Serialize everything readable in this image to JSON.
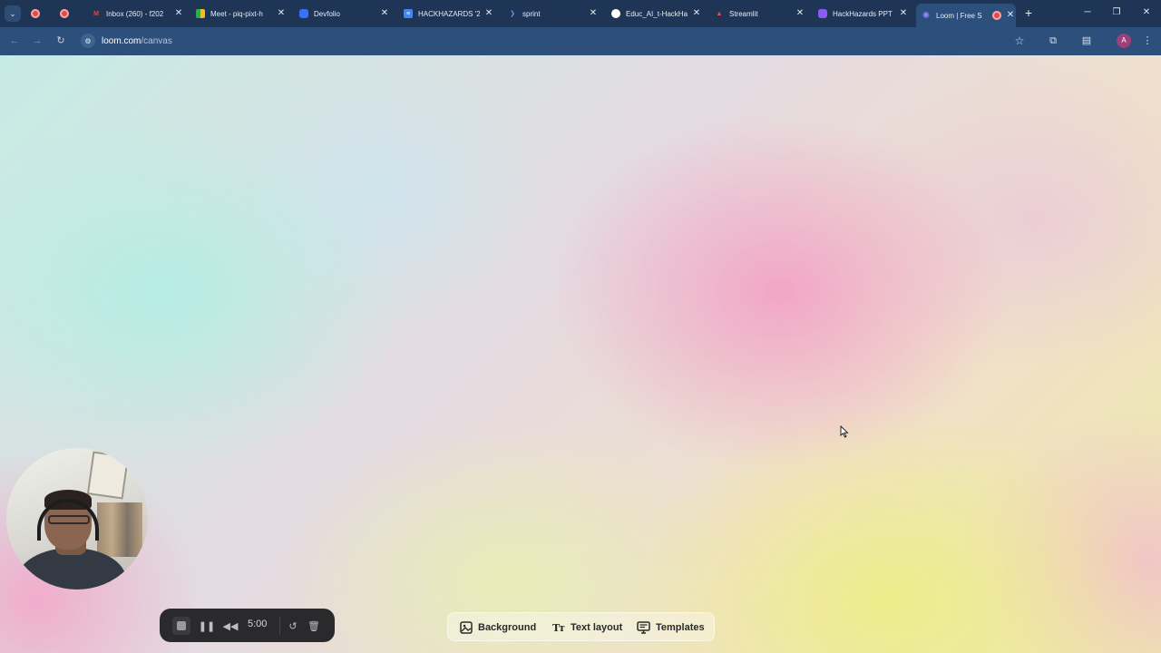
{
  "browser": {
    "tabs": [
      {
        "title": "",
        "favicon": "record-icon",
        "color": "#e5484d"
      },
      {
        "title": "",
        "favicon": "record-icon",
        "color": "#e5484d"
      },
      {
        "title": "Inbox (260) - f202",
        "favicon": "gmail-icon",
        "color": "#ea4335"
      },
      {
        "title": "Meet - piq-pixt-h",
        "favicon": "meet-icon",
        "color": "#34a853"
      },
      {
        "title": "Devfolio",
        "favicon": "devfolio-icon",
        "color": "#3770ff"
      },
      {
        "title": "HACKHAZARDS '2",
        "favicon": "docs-icon",
        "color": "#4285f4"
      },
      {
        "title": "sprint",
        "favicon": "sprint-icon",
        "color": "#6b7cff"
      },
      {
        "title": "Educ_AI_t-HackHa",
        "favicon": "github-icon",
        "color": "#ffffff"
      },
      {
        "title": "Streamlit",
        "favicon": "streamlit-icon",
        "color": "#ff4b4b"
      },
      {
        "title": "HackHazards PPT",
        "favicon": "hackhazards-icon",
        "color": "#8a5cf6"
      },
      {
        "title": "Loom | Free S",
        "favicon": "loom-icon",
        "color": "#625df5",
        "active": true
      }
    ],
    "url_host": "loom.com",
    "url_path": "/canvas",
    "profile_initial": "A"
  },
  "recorder": {
    "timer": "5:00"
  },
  "canvas_tools": {
    "background_label": "Background",
    "text_layout_label": "Text layout",
    "templates_label": "Templates"
  }
}
